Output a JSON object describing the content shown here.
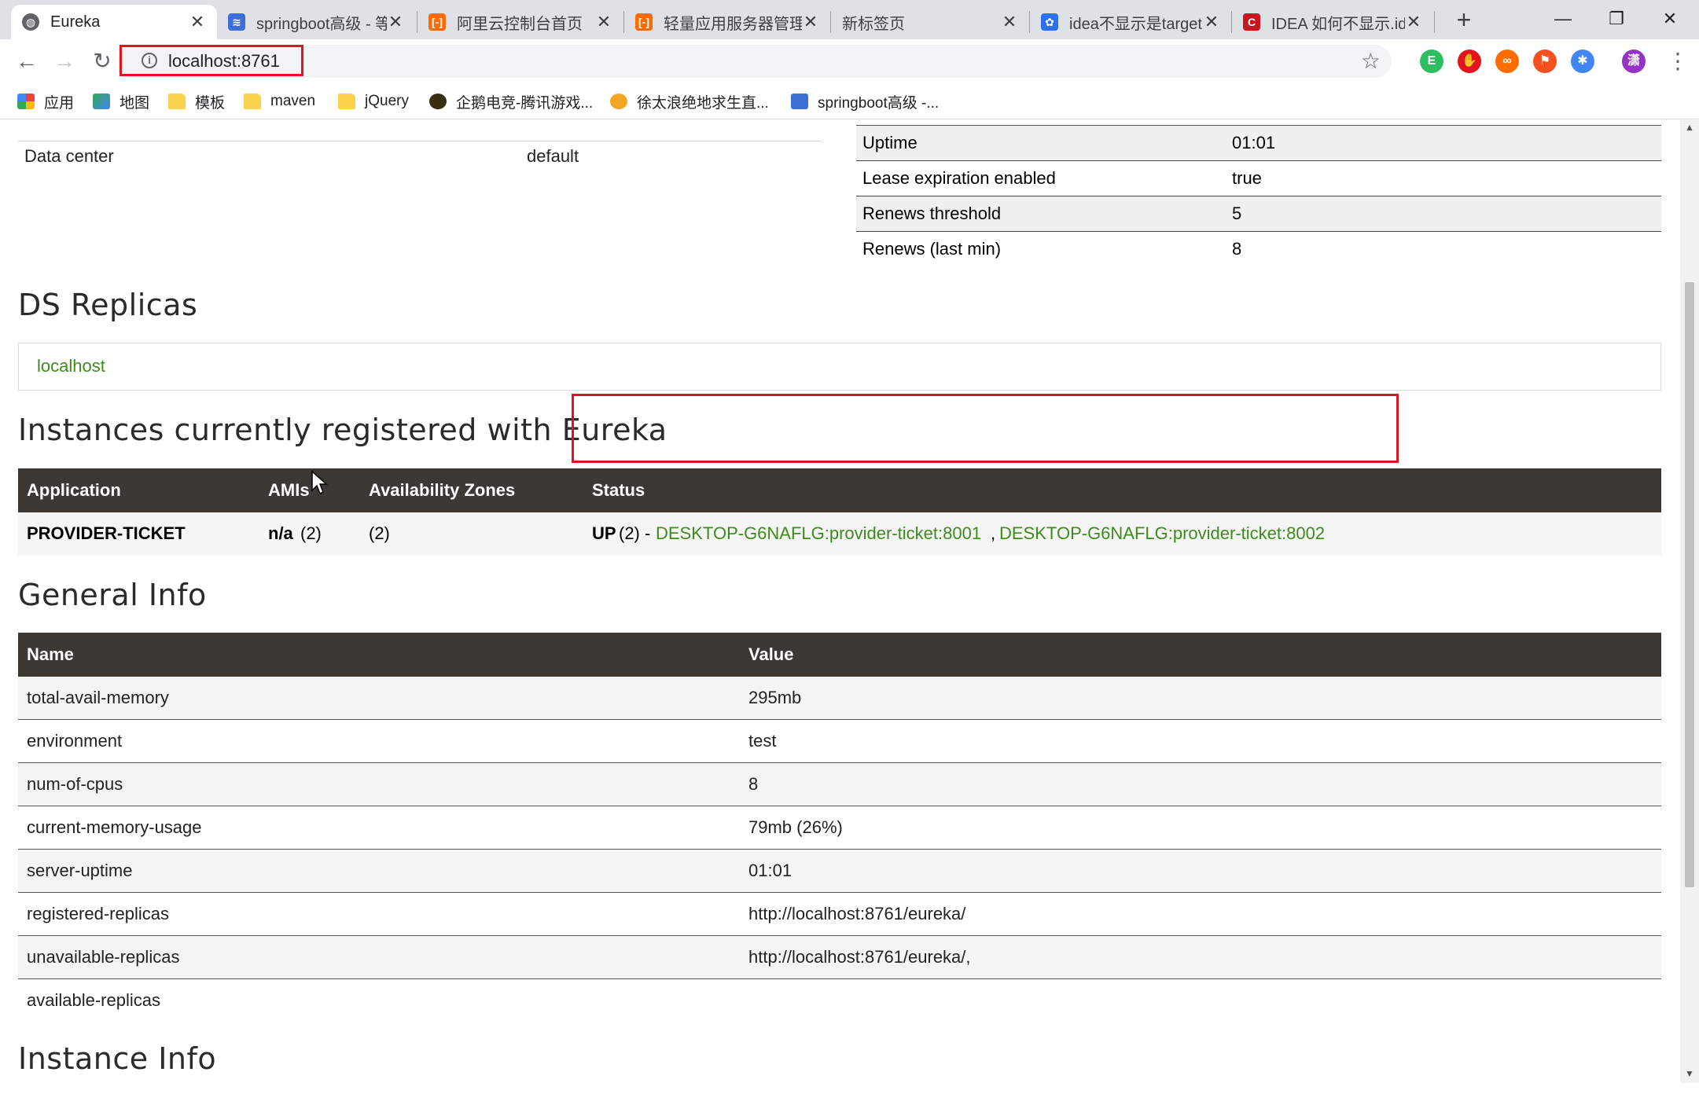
{
  "browser": {
    "tabs": [
      {
        "title": "Eureka",
        "active": true,
        "icon": "globe-icon"
      },
      {
        "title": "springboot高级 - 等",
        "icon": "stack-icon"
      },
      {
        "title": "阿里云控制台首页",
        "icon": "aliyun-icon"
      },
      {
        "title": "轻量应用服务器管理",
        "icon": "aliyun-icon"
      },
      {
        "title": "新标签页",
        "icon": ""
      },
      {
        "title": "idea不显示是target",
        "icon": "baidu-paw-icon"
      },
      {
        "title": "IDEA 如何不显示.id",
        "icon": "csdn-icon"
      }
    ],
    "new_tab": "+",
    "window_controls": {
      "minimize": "—",
      "restore": "❐",
      "close": "✕"
    },
    "url": "localhost:8761",
    "bookmarks": [
      {
        "label": "应用",
        "icon": "apps-grid-icon"
      },
      {
        "label": "地图",
        "icon": "map-icon"
      },
      {
        "label": "模板",
        "icon": "folder-icon"
      },
      {
        "label": "maven",
        "icon": "folder-icon"
      },
      {
        "label": "jQuery",
        "icon": "folder-icon"
      },
      {
        "label": "企鹅电竞-腾讯游戏...",
        "icon": "penguin-esports-icon"
      },
      {
        "label": "徐太浪绝地求生直...",
        "icon": "live-stream-icon"
      },
      {
        "label": "springboot高级 -...",
        "icon": "stack-icon"
      }
    ],
    "extensions": [
      "evernote-icon",
      "adblock-icon",
      "infinity-icon",
      "translate-icon",
      "pinwheel-icon"
    ],
    "profile_initial": "潇"
  },
  "page": {
    "data_center": {
      "label": "Data center",
      "value": "default"
    },
    "lease_info": [
      {
        "key": "Uptime",
        "value": "01:01"
      },
      {
        "key": "Lease expiration enabled",
        "value": "true"
      },
      {
        "key": "Renews threshold",
        "value": "5"
      },
      {
        "key": "Renews (last min)",
        "value": "8"
      }
    ],
    "ds_replicas": {
      "title": "DS Replicas",
      "link": "localhost"
    },
    "instances": {
      "title": "Instances currently registered with Eureka",
      "headers": [
        "Application",
        "AMIs",
        "Availability Zones",
        "Status"
      ],
      "rows": [
        {
          "application": "PROVIDER-TICKET",
          "amis_label": "n/a",
          "amis_count": "(2)",
          "zones": "(2)",
          "status_label": "UP",
          "status_count": "(2) -",
          "instance_1": "DESKTOP-G6NAFLG:provider-ticket:8001",
          "separator": ",",
          "instance_2": "DESKTOP-G6NAFLG:provider-ticket:8002"
        }
      ]
    },
    "general_info": {
      "title": "General Info",
      "headers": [
        "Name",
        "Value"
      ],
      "rows": [
        {
          "name": "total-avail-memory",
          "value": "295mb"
        },
        {
          "name": "environment",
          "value": "test"
        },
        {
          "name": "num-of-cpus",
          "value": "8"
        },
        {
          "name": "current-memory-usage",
          "value": "79mb (26%)"
        },
        {
          "name": "server-uptime",
          "value": "01:01"
        },
        {
          "name": "registered-replicas",
          "value": "http://localhost:8761/eureka/"
        },
        {
          "name": "unavailable-replicas",
          "value": "http://localhost:8761/eureka/,"
        },
        {
          "name": "available-replicas",
          "value": ""
        }
      ]
    },
    "instance_info": {
      "title": "Instance Info"
    }
  },
  "colors": {
    "link_green": "#3e8b1d",
    "table_header": "#3c3834",
    "highlight_red": "#e0141e"
  }
}
